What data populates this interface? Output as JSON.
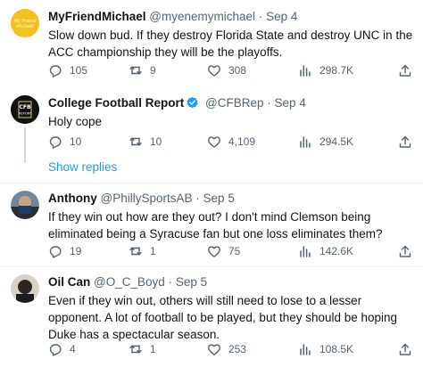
{
  "tweets": [
    {
      "name": "MyFriendMichael",
      "handle": "@myenemymichael",
      "dot": "·",
      "date": "Sep 4",
      "verified": false,
      "text": "Slow down bud. If they destroy Florida State and destroy UNC in the ACC championship they will be the playoffs.",
      "replies": "105",
      "retweets": "9",
      "likes": "308",
      "views": "298.7K"
    },
    {
      "name": "College Football Report",
      "handle": "@CFBRep",
      "dot": "·",
      "date": "Sep 4",
      "verified": true,
      "text": "Holy cope",
      "replies": "10",
      "retweets": "10",
      "likes": "4,109",
      "views": "294.5K",
      "avatar_text": "CFB REPORT"
    },
    {
      "name": "Anthony",
      "handle": "@PhillySportsAB",
      "dot": "·",
      "date": "Sep 5",
      "verified": false,
      "text": "If they win out how are they out? I don't mind Clemson being eliminated being a Syracuse fan but one loss eliminates them?",
      "replies": "19",
      "retweets": "1",
      "likes": "75",
      "views": "142.6K"
    },
    {
      "name": "Oil Can",
      "handle": "@O_C_Boyd",
      "dot": "·",
      "date": "Sep 5",
      "verified": false,
      "text": "Even if they win out, others will still need to lose to a lesser opponent. A lot of football to be played, but they should be hoping Duke has a spectacular season.",
      "replies": "4",
      "retweets": "1",
      "likes": "253",
      "views": "108.5K"
    }
  ],
  "show_replies": "Show replies",
  "icons": {
    "reply": "reply-icon",
    "retweet": "retweet-icon",
    "like": "heart-icon",
    "views": "views-icon",
    "share": "share-icon",
    "verified": "verified-badge-icon"
  },
  "colors": {
    "text": "#0f1419",
    "secondary": "#536471",
    "link": "#1d9bf0",
    "verified": "#1d9bf0",
    "divider": "#eff3f4"
  }
}
